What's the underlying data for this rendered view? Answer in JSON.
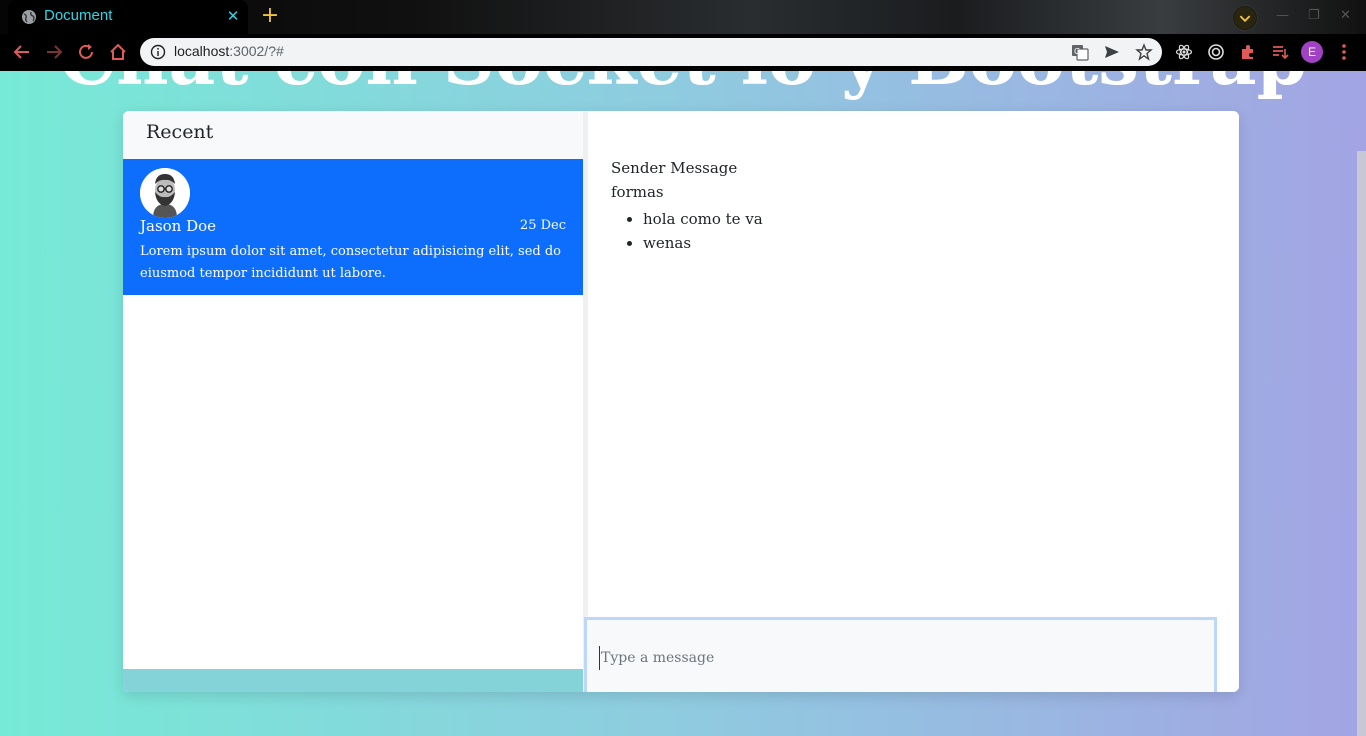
{
  "browser": {
    "tab_title": "Document",
    "tab_close": "✕",
    "new_tab": "+",
    "url_host": "localhost",
    "url_rest": ":3002/?#",
    "profile_initial": "E",
    "accent_color": "#2fd5e6"
  },
  "page": {
    "heading": "Chat con Socket io y Bootstrap"
  },
  "sidebar": {
    "title": "Recent",
    "contacts": [
      {
        "name": "Jason Doe",
        "date": "25 Dec",
        "preview": "Lorem ipsum dolor sit amet, consectetur adipisicing elit, sed do eiusmod tempor incididunt ut labore.",
        "active": true,
        "highlight_color": "#0d6efd"
      }
    ]
  },
  "chat": {
    "sender_label": "Sender Message",
    "message_text": "formas",
    "list_items": [
      "hola como te va",
      "wenas"
    ]
  },
  "compose": {
    "placeholder": "Type a message",
    "value": ""
  }
}
